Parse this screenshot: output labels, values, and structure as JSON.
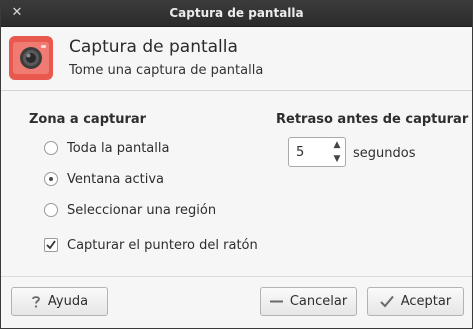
{
  "window": {
    "title": "Captura de pantalla",
    "close_glyph": "✕"
  },
  "header": {
    "title": "Captura de pantalla",
    "subtitle": "Tome una captura de pantalla",
    "icon": "camera-icon",
    "icon_color": "#e8584f"
  },
  "capture_area": {
    "label": "Zona a capturar",
    "options": [
      {
        "label": "Toda la pantalla",
        "selected": false
      },
      {
        "label": "Ventana activa",
        "selected": true
      },
      {
        "label": "Seleccionar una región",
        "selected": false
      }
    ]
  },
  "pointer": {
    "label": "Capturar el puntero del ratón",
    "checked": true
  },
  "delay": {
    "label": "Retraso antes de capturar",
    "value": "5",
    "units": "segundos"
  },
  "buttons": {
    "help": "Ayuda",
    "cancel": "Cancelar",
    "accept": "Aceptar"
  }
}
